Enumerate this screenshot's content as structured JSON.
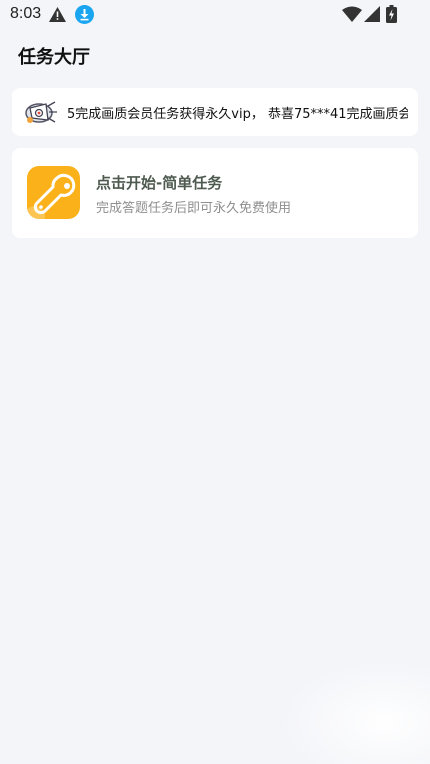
{
  "status_bar": {
    "time": "8:03",
    "icons": [
      "warning-icon",
      "download-icon",
      "wifi-icon",
      "cell-signal-icon",
      "battery-icon"
    ]
  },
  "page": {
    "title": "任务大厅"
  },
  "notice": {
    "icon": "megaphone-icon",
    "text": "5完成画质会员任务获得永久vip， 恭喜75***41完成画质会"
  },
  "task": {
    "icon": "wrench-icon",
    "title": "点击开始-简单任务",
    "description": "完成答题任务后即可永久免费使用"
  },
  "colors": {
    "background": "#f4f5f9",
    "card": "#ffffff",
    "task_icon_bg": "#fbb21a",
    "download_icon": "#1aa5f0",
    "task_title": "#4e5a4f",
    "task_desc": "#8f8f8f"
  }
}
